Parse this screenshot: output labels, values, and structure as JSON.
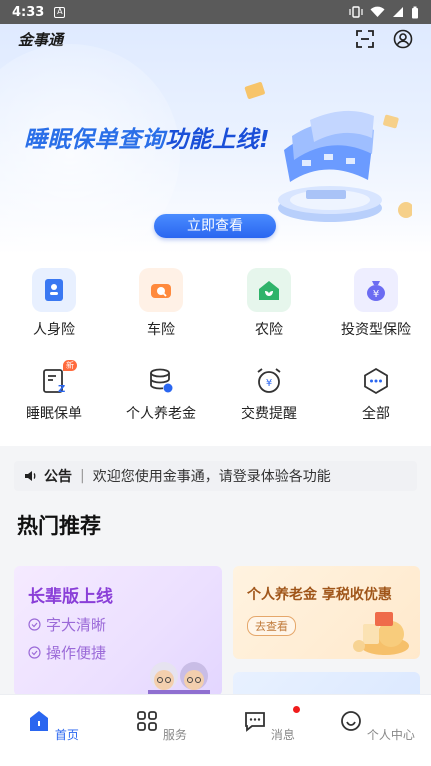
{
  "status_bar": {
    "time": "4:33",
    "app_glyph": "A"
  },
  "app": {
    "name": "金事通"
  },
  "banner": {
    "title_part1": "睡眠保单查询",
    "title_part2": "功能上线!",
    "button": "立即查看"
  },
  "quick_row1": [
    {
      "label": "人身险",
      "icon": "person-card-icon"
    },
    {
      "label": "车险",
      "icon": "car-icon"
    },
    {
      "label": "农险",
      "icon": "farm-house-icon"
    },
    {
      "label": "投资型保险",
      "icon": "money-bag-icon"
    }
  ],
  "quick_row2": [
    {
      "label": "睡眠保单",
      "icon": "sleep-policy-icon",
      "badge": "新"
    },
    {
      "label": "个人养老金",
      "icon": "coins-icon"
    },
    {
      "label": "交费提醒",
      "icon": "alarm-clock-icon"
    },
    {
      "label": "全部",
      "icon": "more-icon"
    }
  ],
  "notice": {
    "tag": "公告",
    "text": "欢迎您使用金事通，请登录体验各功能"
  },
  "section_title": "热门推荐",
  "card_left": {
    "title": "长辈版上线",
    "line1": "字大清晰",
    "line2": "操作便捷"
  },
  "card_right": {
    "title": "个人养老金 享税收优惠",
    "button": "去查看"
  },
  "tabs": [
    {
      "label": "首页",
      "icon": "home-icon",
      "active": true
    },
    {
      "label": "服务",
      "icon": "grid-icon"
    },
    {
      "label": "消息",
      "icon": "message-icon"
    },
    {
      "label": "个人中心",
      "icon": "smile-user-icon"
    }
  ],
  "colors": {
    "primary": "#2a66f0",
    "banner_title": "#2a6fe8",
    "card_purple": "#8a3fd8",
    "card_orange": "#a0561a"
  }
}
